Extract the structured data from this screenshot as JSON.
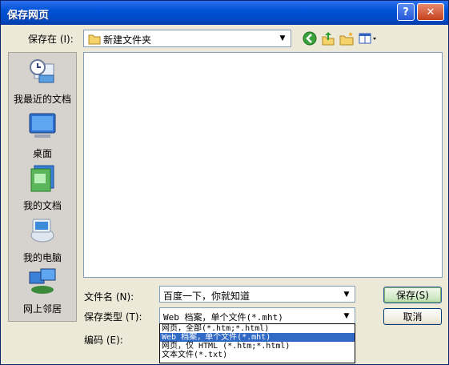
{
  "window": {
    "title": "保存网页"
  },
  "save_in": {
    "label": "保存在 (I):",
    "value": "新建文件夹"
  },
  "places": [
    {
      "label": "我最近的文档",
      "icon": "recent-documents-icon"
    },
    {
      "label": "桌面",
      "icon": "desktop-icon"
    },
    {
      "label": "我的文档",
      "icon": "my-documents-icon"
    },
    {
      "label": "我的电脑",
      "icon": "my-computer-icon"
    },
    {
      "label": "网上邻居",
      "icon": "network-places-icon"
    }
  ],
  "filename": {
    "label": "文件名 (N):",
    "value": "百度一下，你就知道"
  },
  "filetype": {
    "label": "保存类型 (T):",
    "value": "Web 档案，单个文件(*.mht)",
    "options": [
      "网页，全部(*.htm;*.html)",
      "Web 档案，单个文件(*.mht)",
      "网页，仅 HTML (*.htm;*.html)",
      "文本文件(*.txt)"
    ]
  },
  "encoding": {
    "label": "编码 (E):"
  },
  "buttons": {
    "save": "保存(S)",
    "cancel": "取消"
  },
  "caption": {
    "help": "?",
    "close": "✕"
  }
}
